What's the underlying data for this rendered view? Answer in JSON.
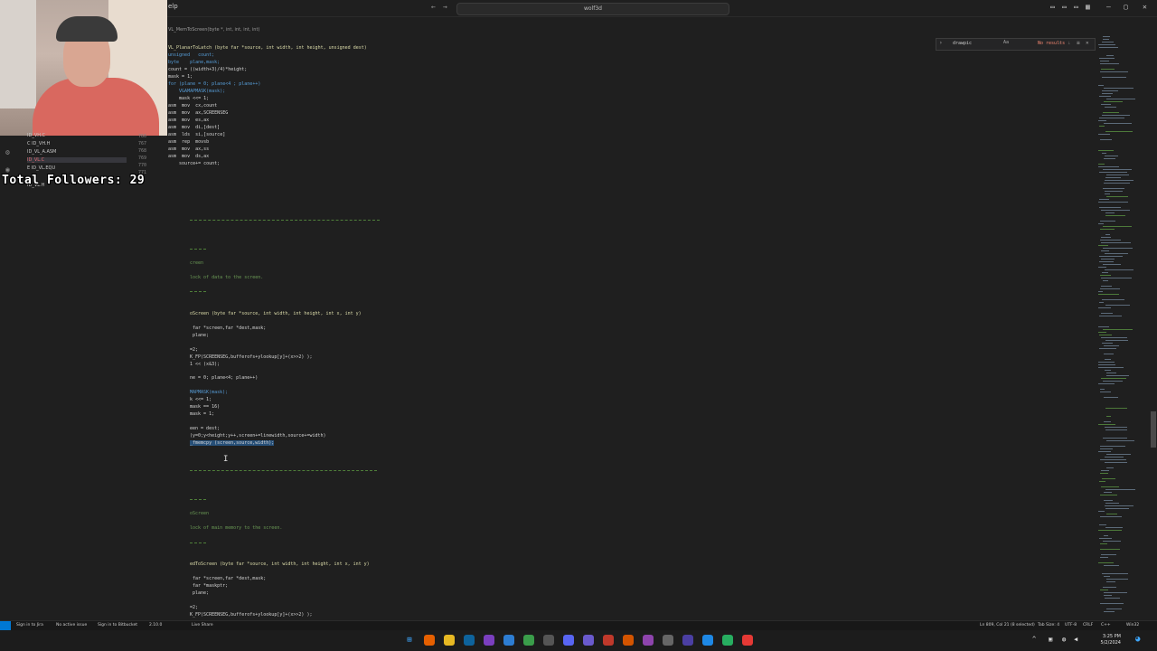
{
  "titlebar": {
    "menu_label": "elp",
    "search_text": "wolf3d"
  },
  "overlay": {
    "followers_label": "Total Followers:",
    "followers_count": "29"
  },
  "sidebar": {
    "files": [
      {
        "label": "ID_VH.C"
      },
      {
        "label": "C  ID_VH.H"
      },
      {
        "label": "ID_VL_A.ASM"
      },
      {
        "label": "ID_VL.C"
      },
      {
        "label": "E  ID_VL.EQU"
      },
      {
        "label": "ID_VL.H"
      }
    ],
    "line_numbers": [
      "766",
      "767",
      "768",
      "769",
      "770",
      "771",
      "772"
    ]
  },
  "editor": {
    "breadcrumb": "VL_MemToScreen(byte *, int, int, int, int)",
    "find": {
      "query": "drawpic",
      "result": "No results"
    },
    "lines": [
      {
        "t": "VL_PlanarToLatch (byte far *source, int width, int height, unsigned dest)"
      },
      {
        "t": "unsigned   count;"
      },
      {
        "t": "byte    plane,mask;"
      },
      {
        "t": ""
      },
      {
        "t": "count = ((width+3)/4)*height;"
      },
      {
        "t": "mask = 1;"
      },
      {
        "t": "for (plane = 0; plane<4 ; plane++)"
      },
      {
        "t": ""
      },
      {
        "t": "    VGAMAPMASK(mask);"
      },
      {
        "t": "    mask <<= 1;"
      },
      {
        "t": ""
      },
      {
        "t": "asm  mov  cx,count"
      },
      {
        "t": "asm  mov  ax,SCREENSEG"
      },
      {
        "t": "asm  mov  es,ax"
      },
      {
        "t": "asm  mov  di,[dest]"
      },
      {
        "t": "asm  lds  si,[source]"
      },
      {
        "t": "asm  rep  movsb"
      },
      {
        "t": "asm  mov  ax,ss"
      },
      {
        "t": "asm  mov  ds,ax"
      },
      {
        "t": ""
      },
      {
        "t": "    source+= count;"
      }
    ],
    "lines2": [
      {
        "t": "creen"
      },
      {
        "t": "lock of data to the screen."
      },
      {
        "t": ""
      },
      {
        "t": "oScreen (byte far *source, int width, int height, int x, int y)"
      },
      {
        "t": " far *screen,far *dest,mask;"
      },
      {
        "t": " plane;"
      },
      {
        "t": "=2;"
      },
      {
        "t": "K_FP(SCREENSEG,bufferofs+ylookup[y]+(x>>2) );"
      },
      {
        "t": "1 << (x&3);"
      },
      {
        "t": "ne = 0; plane<4; plane++)"
      },
      {
        "t": "MAPMASK(mask);"
      },
      {
        "t": "k <<= 1;"
      },
      {
        "t": "mask == 16)"
      },
      {
        "t": "mask = 1;"
      },
      {
        "t": "een = dest;"
      },
      {
        "t": "(y=0;y<height;y++,screen+=linewidth,source+=width)"
      },
      {
        "t": "_fmemcpy (screen,source,width);"
      }
    ],
    "lines3": [
      {
        "t": "oScreen"
      },
      {
        "t": "lock of main memory to the screen."
      },
      {
        "t": "edToScreen (byte far *source, int width, int height, int x, int y)"
      },
      {
        "t": " far *screen,far *dest,mask;"
      },
      {
        "t": " far *maskptr;"
      },
      {
        "t": " plane;"
      },
      {
        "t": "=2;"
      },
      {
        "t": "K_FP(SCREENSEG,bufferofs+ylookup[y]+(x>>2) );"
      }
    ]
  },
  "statusbar": {
    "left": [
      "Sign in to Jira",
      "No active issue",
      "Sign in to Bitbucket",
      "2.10.0",
      "Live Share"
    ],
    "position": "Ln 809, Col 21 (8 selected)",
    "tab_size": "Tab Size: 4",
    "encoding": "UTF-8",
    "eol": "CRLF",
    "language": "C++",
    "platform": "Win32"
  },
  "taskbar": {
    "time": "3:25 PM",
    "date": "5/2/2024"
  },
  "colors": {
    "editor_bg": "#1f1f1f",
    "statusbar_bg": "#181818",
    "remote_badge": "#0078d4",
    "keyword": "#569cd6",
    "comment": "#6a9955"
  }
}
